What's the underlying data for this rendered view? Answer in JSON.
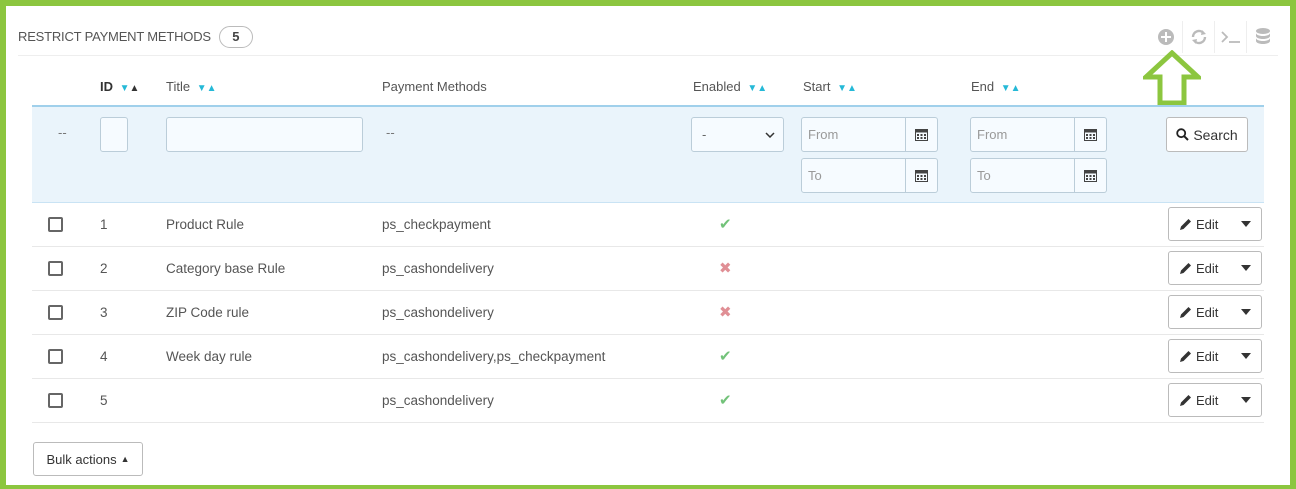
{
  "panel": {
    "title": "RESTRICT PAYMENT METHODS",
    "count": "5",
    "toolbar_icons": [
      "add-icon",
      "refresh-icon",
      "terminal-icon",
      "database-icon"
    ]
  },
  "table": {
    "headers": {
      "id": "ID",
      "title": "Title",
      "payment_methods": "Payment Methods",
      "enabled": "Enabled",
      "start": "Start",
      "end": "End"
    },
    "filters": {
      "placeholder_dash": "--",
      "payment_methods_dash": "--",
      "enabled_value": "-",
      "start_from": "From",
      "start_to": "To",
      "end_from": "From",
      "end_to": "To",
      "search_label": "Search"
    },
    "rows": [
      {
        "id": "1",
        "title": "Product Rule",
        "payment_methods": "ps_checkpayment",
        "enabled": true
      },
      {
        "id": "2",
        "title": "Category base Rule",
        "payment_methods": "ps_cashondelivery",
        "enabled": false
      },
      {
        "id": "3",
        "title": "ZIP Code rule",
        "payment_methods": "ps_cashondelivery",
        "enabled": false
      },
      {
        "id": "4",
        "title": "Week day rule",
        "payment_methods": "ps_cashondelivery,ps_checkpayment",
        "enabled": true
      },
      {
        "id": "5",
        "title": "",
        "payment_methods": "ps_cashondelivery",
        "enabled": true
      }
    ],
    "edit_label": "Edit"
  },
  "bulk_actions_label": "Bulk actions",
  "colors": {
    "highlight_border": "#8cc63f",
    "sort_arrow": "#25b9d7",
    "enabled_yes": "#72c279",
    "enabled_no": "#e08f95",
    "filter_bg": "#eaf4fb"
  }
}
